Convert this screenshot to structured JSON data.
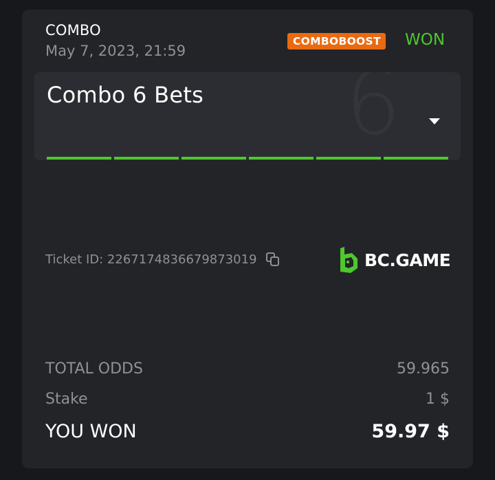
{
  "bet": {
    "type": "COMBO",
    "datetime": "May 7, 2023, 21:59",
    "badge": "COMBOBOOST",
    "status": "WON"
  },
  "combo": {
    "title": "Combo 6 Bets",
    "count": "6",
    "legs_won": 6,
    "legs_total": 6,
    "dropdown_icon": "caret-down-icon"
  },
  "ticket": {
    "label": "Ticket ID: 2267174836679873019",
    "copy_icon": "copy-icon"
  },
  "brand": {
    "name": "BC.GAME",
    "logo_icon": "bc-game-logo-icon"
  },
  "summary": {
    "total_odds_label": "TOTAL ODDS",
    "total_odds_value": "59.965",
    "stake_label": "Stake",
    "stake_value": "1 $",
    "won_label": "YOU WON",
    "won_value": "59.97 $"
  },
  "colors": {
    "background": "#17181b",
    "card": "#232428",
    "accent_green": "#4fc72f",
    "badge_orange": "#ea6a12",
    "muted_text": "#8f9196"
  }
}
